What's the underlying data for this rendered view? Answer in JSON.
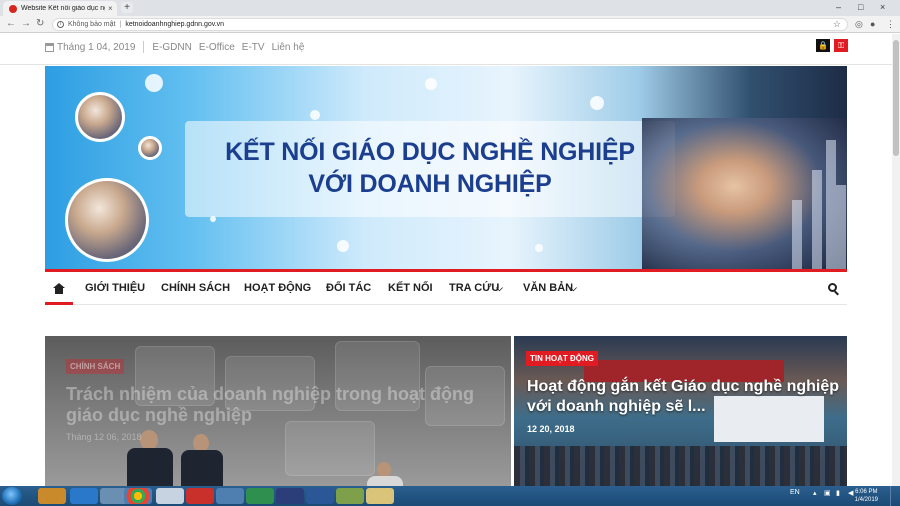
{
  "browser": {
    "tab_title": "Website Kết nối giáo dục nghề ng",
    "tab_close": "×",
    "new_tab": "+",
    "security_label": "Không bảo mật",
    "separator": "|",
    "url": "ketnoidoanhnghiep.gdnn.gov.vn",
    "window_controls": [
      "–",
      "□",
      "×"
    ]
  },
  "topbar": {
    "date": "Tháng 1 04, 2019",
    "links": [
      "E-GDNN",
      "E-Office",
      "E-TV",
      "Liên hệ"
    ]
  },
  "banner": {
    "title_line1": "KẾT NỐI GIÁO DỤC NGHỀ NGHIỆP",
    "title_line2": "VỚI DOANH NGHIỆP"
  },
  "nav": {
    "items": [
      "GIỚI THIỆU",
      "CHÍNH SÁCH",
      "HOẠT ĐỘNG",
      "ĐỐI TÁC",
      "KẾT NỐI",
      "TRA CỨU",
      "VĂN BẢN"
    ]
  },
  "featured": {
    "left": {
      "badge": "CHÍNH SÁCH",
      "title": "Trách nhiệm của doanh nghiệp trong hoạt động giáo dục nghề nghiệp",
      "date": "Tháng 12 06, 2018"
    },
    "right": {
      "badge": "TIN HOẠT ĐỘNG",
      "title": "Hoạt động gắn kết Giáo dục nghề nghiệp với doanh nghiệp sẽ l...",
      "date": "12 20, 2018"
    }
  },
  "taskbar": {
    "lang": "EN",
    "time": "6:06 PM",
    "date": "1/4/2019"
  },
  "colors": {
    "accent_red": "#e11b22",
    "banner_title": "#1b3e8f"
  }
}
